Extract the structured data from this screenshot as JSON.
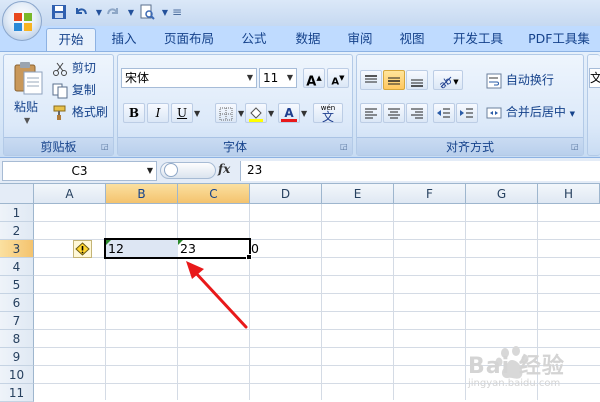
{
  "ribbon": {
    "tabs": [
      "开始",
      "插入",
      "页面布局",
      "公式",
      "数据",
      "审阅",
      "视图",
      "开发工具",
      "PDF工具集"
    ],
    "clipboard": {
      "paste": "粘贴",
      "cut": "剪切",
      "copy": "复制",
      "format_painter": "格式刷",
      "label": "剪贴板"
    },
    "font": {
      "name": "宋体",
      "size": "11",
      "label": "字体",
      "bold": "B",
      "italic": "I",
      "underline": "U",
      "grow": "A",
      "shrink": "A",
      "font_color": "A",
      "phonetic": "wén",
      "phonetic_char": "文"
    },
    "alignment": {
      "wrap_text": "自动换行",
      "merge_center": "合并后居中",
      "label": "对齐方式"
    },
    "next_group_partial": "文"
  },
  "formula_bar": {
    "name_box": "C3",
    "fx": "fx",
    "value": "23"
  },
  "sheet": {
    "columns": [
      "A",
      "B",
      "C",
      "D",
      "E",
      "F",
      "G",
      "H"
    ],
    "rows": [
      "1",
      "2",
      "3",
      "4",
      "5",
      "6",
      "7",
      "8",
      "9",
      "10",
      "11"
    ],
    "cells": {
      "B3": "12",
      "C3": "23",
      "D3": "0"
    }
  },
  "watermark": "Bai 经验",
  "colors": {
    "accent": "#15428b",
    "selection": "#f4c36e",
    "arrow": "#e8191a"
  }
}
